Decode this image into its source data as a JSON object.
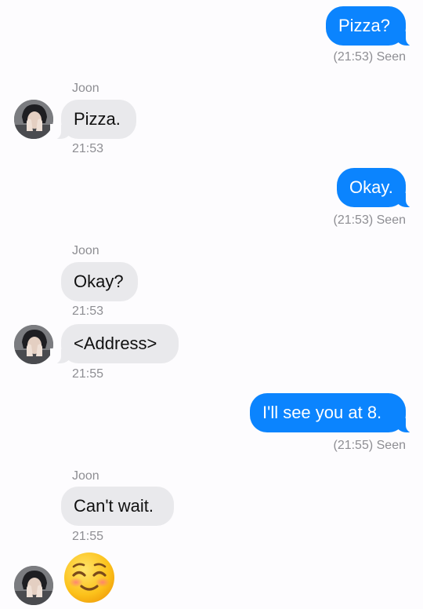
{
  "messages": [
    {
      "direction": "out",
      "text": "Pizza?",
      "status": "(21:53) Seen"
    },
    {
      "direction": "in",
      "sender": "Joon",
      "text": "Pizza.",
      "time": "21:53"
    },
    {
      "direction": "out",
      "text": "Okay.",
      "status": "(21:53) Seen"
    },
    {
      "direction": "in",
      "sender": "Joon",
      "text": "Okay?",
      "time": "21:53"
    },
    {
      "direction": "in",
      "text": "<Address>",
      "time": "21:55"
    },
    {
      "direction": "out",
      "text": "I'll see you at 8.",
      "status": "(21:55) Seen"
    },
    {
      "direction": "in",
      "sender": "Joon",
      "text": "Can't wait.",
      "time": "21:55"
    },
    {
      "direction": "in",
      "emoji": "smiling-face-with-rosy-cheeks"
    }
  ],
  "colors": {
    "outgoing_bubble": "#0b84fe",
    "incoming_bubble": "#e9e9ec",
    "meta_text": "#8e8e93",
    "background": "#fdfcfe"
  }
}
